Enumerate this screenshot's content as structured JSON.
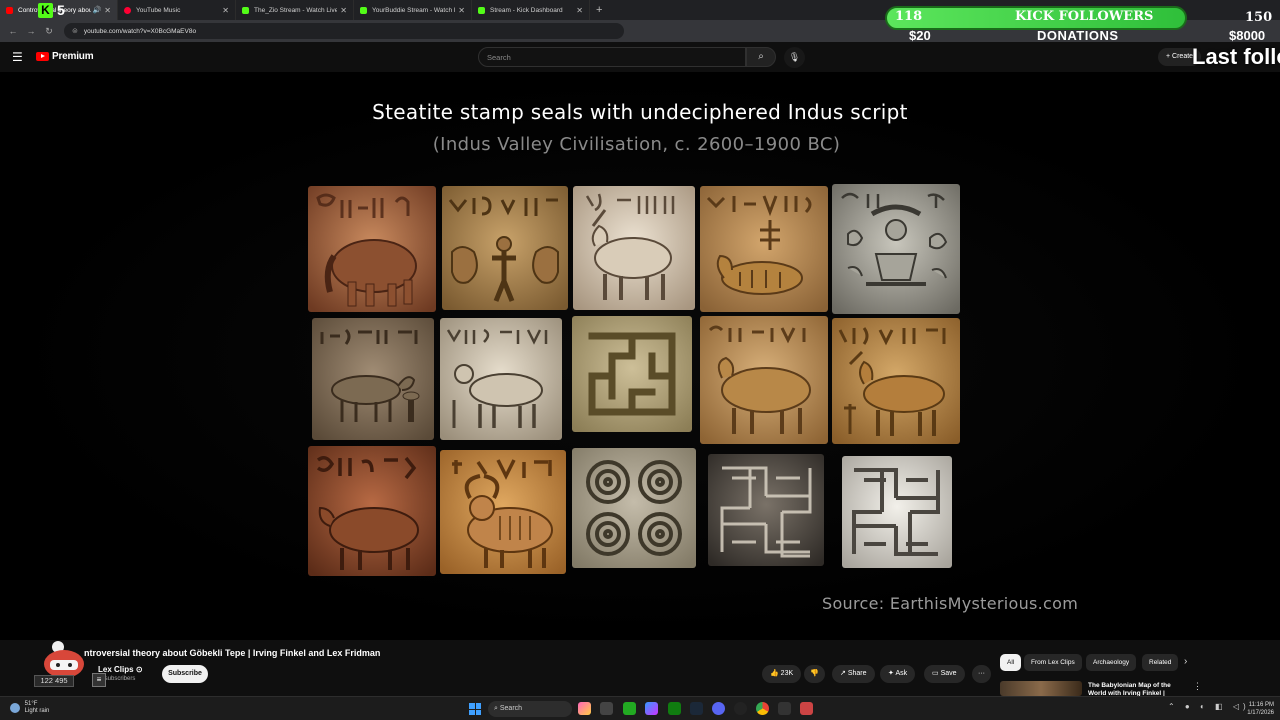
{
  "browser": {
    "tabs": [
      {
        "title": "Controversial theory about",
        "active": true,
        "fav": "#ff0000"
      },
      {
        "title": "YouTube Music",
        "active": false,
        "fav": "#ff0033"
      },
      {
        "title": "The_Zio Stream - Watch Live on",
        "active": false,
        "fav": "#53fc18"
      },
      {
        "title": "YourBuddie Stream - Watch Live",
        "active": false,
        "fav": "#53fc18"
      },
      {
        "title": "Stream - Kick Dashboard",
        "active": false,
        "fav": "#53fc18"
      }
    ],
    "new_tab": "+",
    "url": "youtube.com/watch?v=X0BcGMaEV8o"
  },
  "youtube": {
    "logo_text": "Premium",
    "search_placeholder": "Search",
    "create_label": "Create"
  },
  "slide": {
    "title": "Steatite stamp seals with undeciphered Indus script",
    "subtitle": "(Indus Valley Civilisation, c. 2600–1900 BC)",
    "source_label": "Source: ",
    "source_site": "EarthisMysterious.com"
  },
  "overlay": {
    "follower_count": "118",
    "follower_label": "KICK FOLLOWERS",
    "follower_goal": "150",
    "donation_amount": "$20",
    "donation_label": "DONATIONS",
    "donation_goal": "$8000",
    "last_follower_label": "Last followe",
    "kick_badge": "5"
  },
  "video": {
    "title": "ntroversial theory about Göbekli Tepe | Irving Finkel and Lex Fridman",
    "channel": "Lex Clips",
    "subs": "M subscribers",
    "viewer_count": "122 495",
    "subscribe_label": "Subscribe",
    "likes": "23K",
    "share_label": "Share",
    "ask_label": "Ask",
    "save_label": "Save",
    "more_label": "···",
    "chips": [
      "All",
      "From Lex Clips",
      "Archaeology",
      "Related"
    ],
    "rec_title": "The Babylonian Map of the World with Irving Finkel |"
  },
  "taskbar": {
    "temp": "51°F",
    "weather": "Light rain",
    "search_label": "Search",
    "time": "11:16 PM",
    "date": "1/17/2026"
  },
  "colors": {
    "kick_green": "#53fc18",
    "yt_red": "#ff0000"
  }
}
